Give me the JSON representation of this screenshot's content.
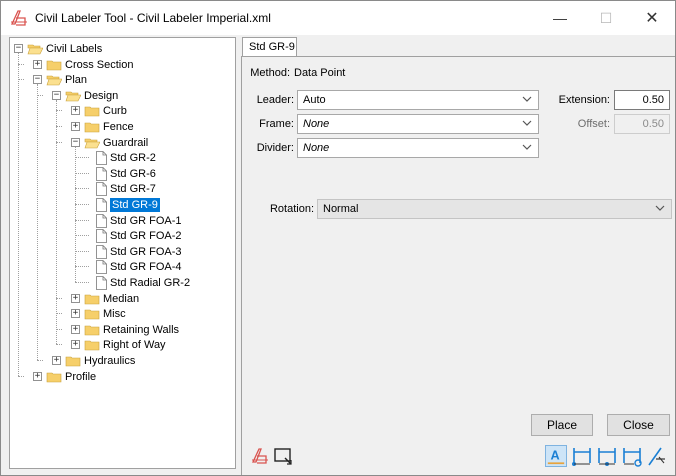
{
  "window": {
    "title": "Civil Labeler Tool - Civil Labeler Imperial.xml",
    "minimize_glyph": "—",
    "maximize_glyph": "☐",
    "close_glyph": "✕"
  },
  "tree": {
    "nodes": [
      {
        "label": "Civil Labels",
        "expander": "−"
      },
      {
        "label": "Cross Section",
        "expander": "+"
      },
      {
        "label": "Plan",
        "expander": "−"
      },
      {
        "label": "Design",
        "expander": "−"
      },
      {
        "label": "Curb",
        "expander": "+"
      },
      {
        "label": "Fence",
        "expander": "+"
      },
      {
        "label": "Guardrail",
        "expander": "−"
      },
      {
        "label": "Std GR-2"
      },
      {
        "label": "Std GR-6"
      },
      {
        "label": "Std GR-7"
      },
      {
        "label": "Std GR-9",
        "selected": true
      },
      {
        "label": "Std GR FOA-1"
      },
      {
        "label": "Std GR FOA-2"
      },
      {
        "label": "Std GR FOA-3"
      },
      {
        "label": "Std GR FOA-4"
      },
      {
        "label": "Std Radial GR-2"
      },
      {
        "label": "Median",
        "expander": "+"
      },
      {
        "label": "Misc",
        "expander": "+"
      },
      {
        "label": "Retaining Walls",
        "expander": "+"
      },
      {
        "label": "Right of Way",
        "expander": "+"
      },
      {
        "label": "Hydraulics",
        "expander": "+"
      },
      {
        "label": "Profile",
        "expander": "+"
      }
    ]
  },
  "tab": {
    "label": "Std GR-9"
  },
  "form": {
    "method_label": "Method:",
    "method_value": "Data Point",
    "leader_label": "Leader:",
    "leader_value": "Auto",
    "frame_label": "Frame:",
    "frame_value": "None",
    "divider_label": "Divider:",
    "divider_value": "None",
    "extension_label": "Extension:",
    "extension_value": "0.50",
    "offset_label": "Offset:",
    "offset_value": "0.50",
    "rotation_label": "Rotation:",
    "rotation_value": "Normal"
  },
  "buttons": {
    "place": "Place",
    "close": "Close"
  },
  "icons": {
    "app": "labeler-app-icon",
    "left_tools": [
      "labeler-pick-icon",
      "window-select-icon"
    ],
    "right_tools": [
      "text-label-icon",
      "dimension-left-icon",
      "dimension-between-icon",
      "dimension-right-icon",
      "slope-label-icon"
    ]
  },
  "colors": {
    "selection": "#0078d7",
    "folder": "#f6cf6a",
    "accent_icon": "#1a7fd4"
  }
}
